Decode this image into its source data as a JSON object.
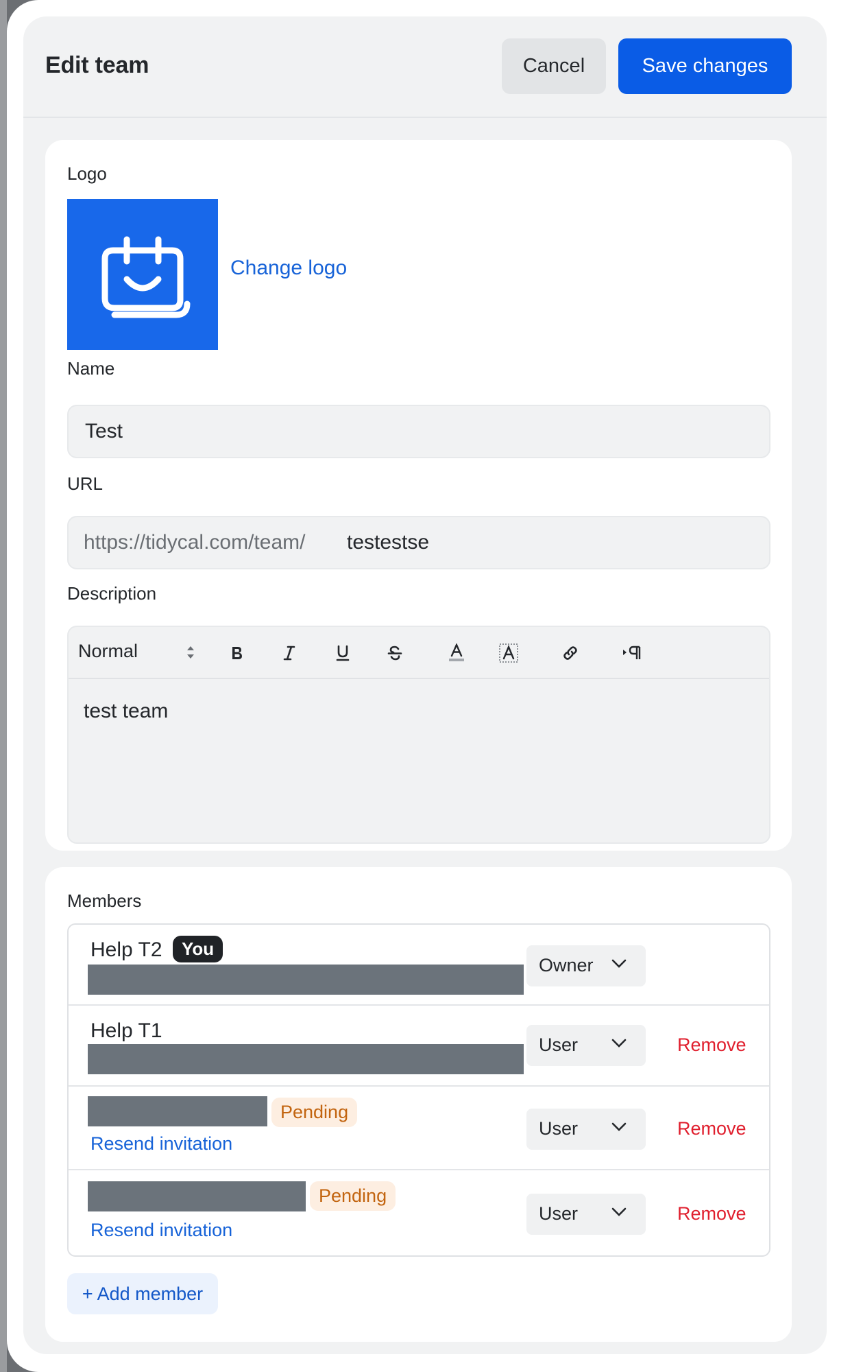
{
  "header": {
    "title": "Edit team",
    "cancel_label": "Cancel",
    "save_label": "Save changes"
  },
  "logo": {
    "label": "Logo",
    "change_label": "Change logo",
    "bg_color": "#1868ea",
    "icon": "calendar-smile-icon"
  },
  "name": {
    "label": "Name",
    "value": "Test"
  },
  "url": {
    "label": "URL",
    "prefix": "https://tidycal.com/team/",
    "value": "testestse"
  },
  "description": {
    "label": "Description",
    "format_select": "Normal",
    "toolbar_icons": [
      "bold-icon",
      "italic-icon",
      "underline-icon",
      "strikethrough-icon",
      "text-color-icon",
      "highlight-color-icon",
      "link-icon",
      "text-direction-icon"
    ],
    "value": "test team"
  },
  "members": {
    "label": "Members",
    "rows": [
      {
        "name": "Help T2",
        "badge": "You",
        "role": "Owner",
        "remove": ""
      },
      {
        "name": "Help T1",
        "badge": "",
        "role": "User",
        "remove": "Remove"
      },
      {
        "name": "",
        "badge": "Pending",
        "resend": "Resend invitation",
        "role": "User",
        "remove": "Remove"
      },
      {
        "name": "",
        "badge": "Pending",
        "resend": "Resend invitation",
        "role": "User",
        "remove": "Remove"
      }
    ],
    "add_label": "+ Add member"
  },
  "colors": {
    "primary": "#0a5ce6",
    "link": "#1763d8",
    "danger": "#e01f2e",
    "pending_bg": "#fdeee1",
    "pending_text": "#c2640f"
  }
}
